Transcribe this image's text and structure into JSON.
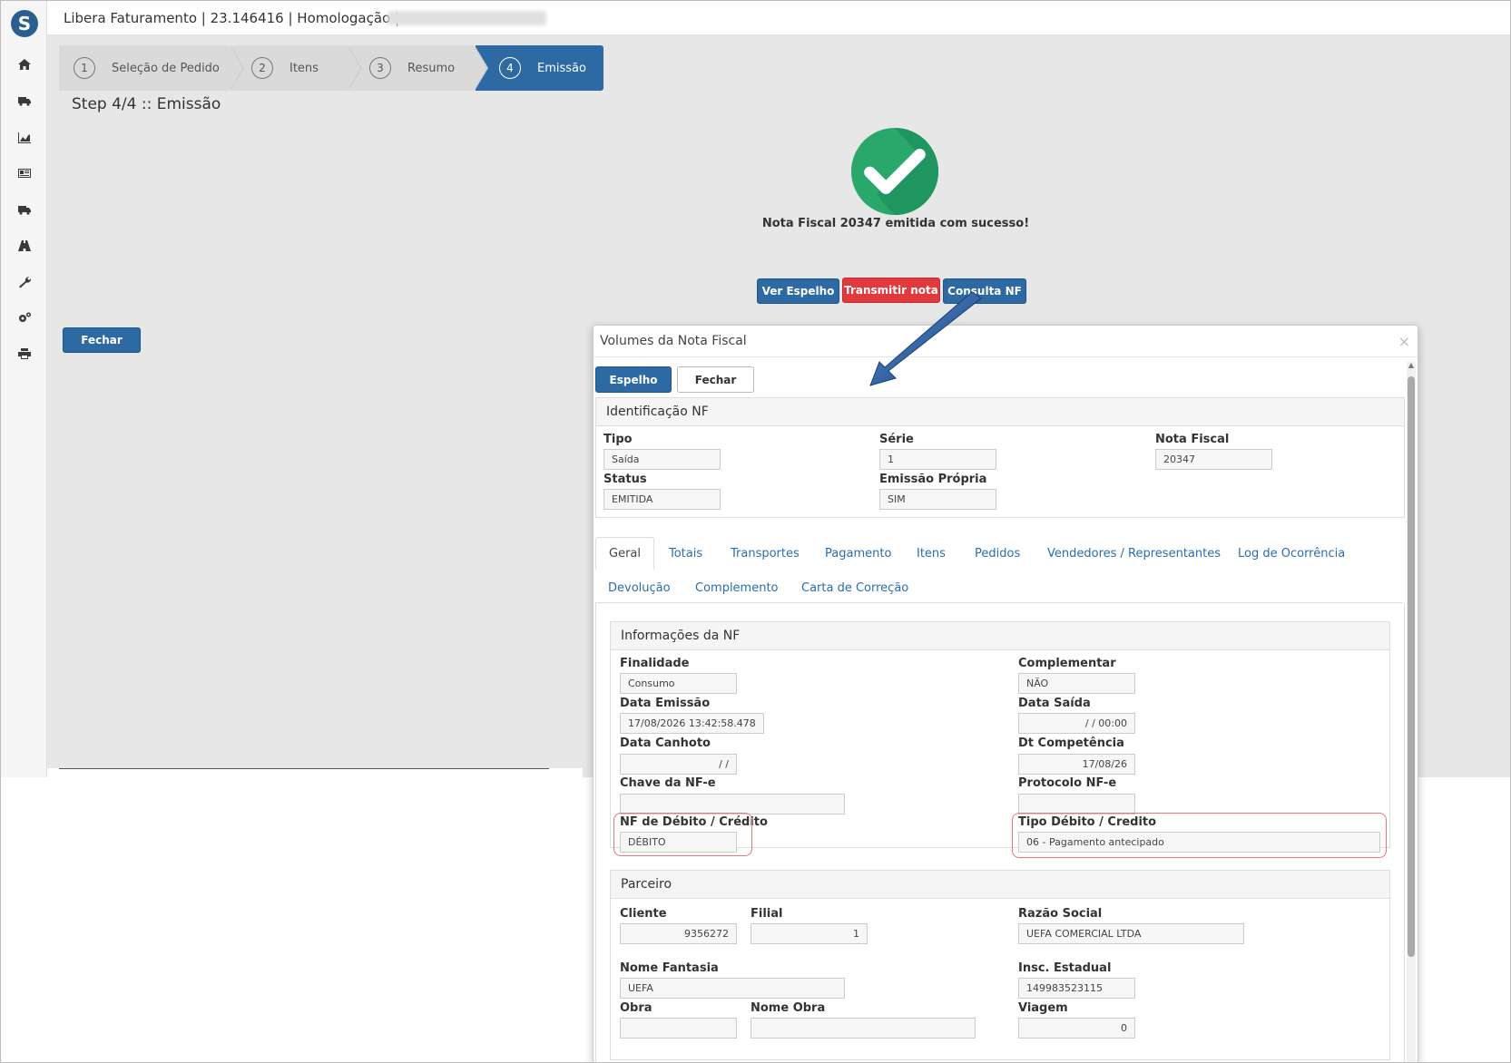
{
  "header": {
    "title": "Libera Faturamento | 23.146416 | Homologação |"
  },
  "sidebar": {
    "logo_letter": "S",
    "icons": [
      "home-icon",
      "truck-icon",
      "chart-icon",
      "newspaper-icon",
      "truck-icon",
      "road-icon",
      "wrench-icon",
      "cogs-icon",
      "print-icon"
    ]
  },
  "wizard": {
    "steps": [
      {
        "num": "1",
        "label": "Seleção de Pedido"
      },
      {
        "num": "2",
        "label": "Itens"
      },
      {
        "num": "3",
        "label": "Resumo"
      },
      {
        "num": "4",
        "label": "Emissão"
      }
    ],
    "active_step": 4,
    "step_title": "Step 4/4 :: Emissão"
  },
  "result": {
    "message": "Nota Fiscal 20347 emitida com sucesso!",
    "ver_espelho": "Ver Espelho",
    "transmitir": "Transmitir nota",
    "consulta": "Consulta NF",
    "fechar": "Fechar"
  },
  "modal": {
    "title": "Volumes da Nota Fiscal",
    "close": "×",
    "espelho_btn": "Espelho",
    "fechar_btn": "Fechar",
    "identificacao": {
      "title": "Identificação NF",
      "tipo_label": "Tipo",
      "tipo": "Saída",
      "serie_label": "Série",
      "serie": "1",
      "nf_label": "Nota Fiscal",
      "nf": "20347",
      "status_label": "Status",
      "status": "EMITIDA",
      "emissao_label": "Emissão Própria",
      "emissao": "SIM"
    },
    "tabs": [
      "Geral",
      "Totais",
      "Transportes",
      "Pagamento",
      "Itens",
      "Pedidos",
      "Vendedores / Representantes",
      "Log de Ocorrência",
      "Devolução",
      "Complemento",
      "Carta de Correção"
    ],
    "info": {
      "title": "Informações da NF",
      "finalidade_label": "Finalidade",
      "finalidade": "Consumo",
      "complementar_label": "Complementar",
      "complementar": "NÃO",
      "data_emissao_label": "Data Emissão",
      "data_emissao": "17/08/2026 13:42:58.478",
      "data_saida_label": "Data Saída",
      "data_saida": "/ / 00:00",
      "data_canhoto_label": "Data Canhoto",
      "data_canhoto": "/ /",
      "dt_competencia_label": "Dt Competência",
      "dt_competencia": "17/08/26",
      "chave_label": "Chave da NF-e",
      "chave": "",
      "protocolo_label": "Protocolo NF-e",
      "protocolo": "",
      "nf_debito_label": "NF de Débito / Crédito",
      "nf_debito": "DÉBITO",
      "tipo_debito_label": "Tipo Débito / Credito",
      "tipo_debito": "06 - Pagamento antecipado"
    },
    "parceiro": {
      "title": "Parceiro",
      "cliente_label": "Cliente",
      "cliente": "9356272",
      "filial_label": "Filial",
      "filial": "1",
      "razao_label": "Razão Social",
      "razao": "UEFA COMERCIAL LTDA",
      "fantasia_label": "Nome Fantasia",
      "fantasia": "UEFA",
      "insc_label": "Insc. Estadual",
      "insc": "149983523115",
      "obra_label": "Obra",
      "obra": "",
      "nome_obra_label": "Nome Obra",
      "nome_obra": "",
      "viagem_label": "Viagem",
      "viagem": "0"
    }
  },
  "colors": {
    "primary": "#2d6aa3",
    "danger": "#e0393e",
    "success": "#2aa86b",
    "highlight": "#e07a80"
  }
}
